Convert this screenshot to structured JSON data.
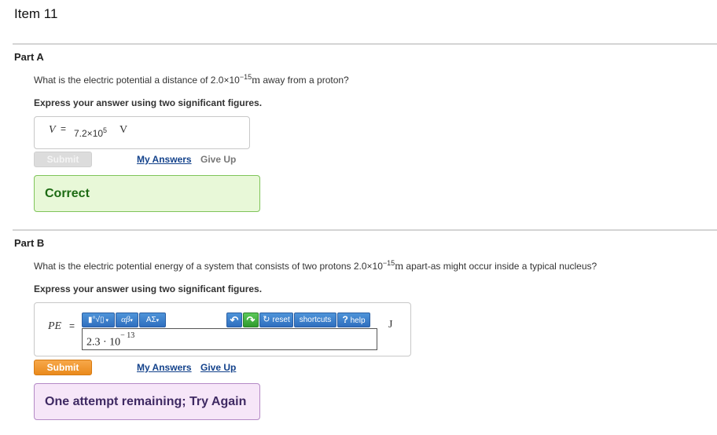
{
  "item": {
    "title": "Item 11"
  },
  "part_a": {
    "title": "Part A",
    "question_pre": "What is the electric potential a distance of 2.0×10",
    "question_exp": "−15",
    "question_unit": "m",
    "question_post": " away from a proton?",
    "instruction": "Express your answer using two significant figures.",
    "answer": {
      "variable": "V",
      "equals": "=",
      "value_base": "7.2×10",
      "value_exp": "5",
      "unit": "V"
    },
    "submit_label": "Submit",
    "my_answers_label": "My Answers",
    "give_up_label": "Give Up",
    "feedback": "Correct",
    "colors": {
      "correct_bg": "#e8f8d8",
      "correct_text": "#1c6b13"
    }
  },
  "part_b": {
    "title": "Part B",
    "question_pre": "What is the electric potential energy of a system that consists of two protons 2.0×10",
    "question_exp": "−15",
    "question_unit": "m",
    "question_post": " apart-as might occur inside a typical nucleus?",
    "instruction": "Express your answer using two significant figures.",
    "answer": {
      "variable": "PE",
      "equals": "=",
      "input_base": "2.3 · 10",
      "input_exp": "− 13",
      "unit": "J"
    },
    "toolbar": {
      "templates_label": "▮°√▯",
      "greek_label": "αβ",
      "symbols_label": "ΑΣ",
      "undo_label": "↶",
      "redo_label": "↷",
      "reset_label": "reset",
      "shortcuts_label": "shortcuts",
      "help_label": "help",
      "help_glyph": "?"
    },
    "submit_label": "Submit",
    "my_answers_label": "My Answers",
    "give_up_label": "Give Up",
    "feedback": "One attempt remaining; Try Again",
    "colors": {
      "submit_orange": "#ea8a1c",
      "retry_bg": "#f6e6f8",
      "toolbar_blue": "#2f6fbf"
    }
  }
}
